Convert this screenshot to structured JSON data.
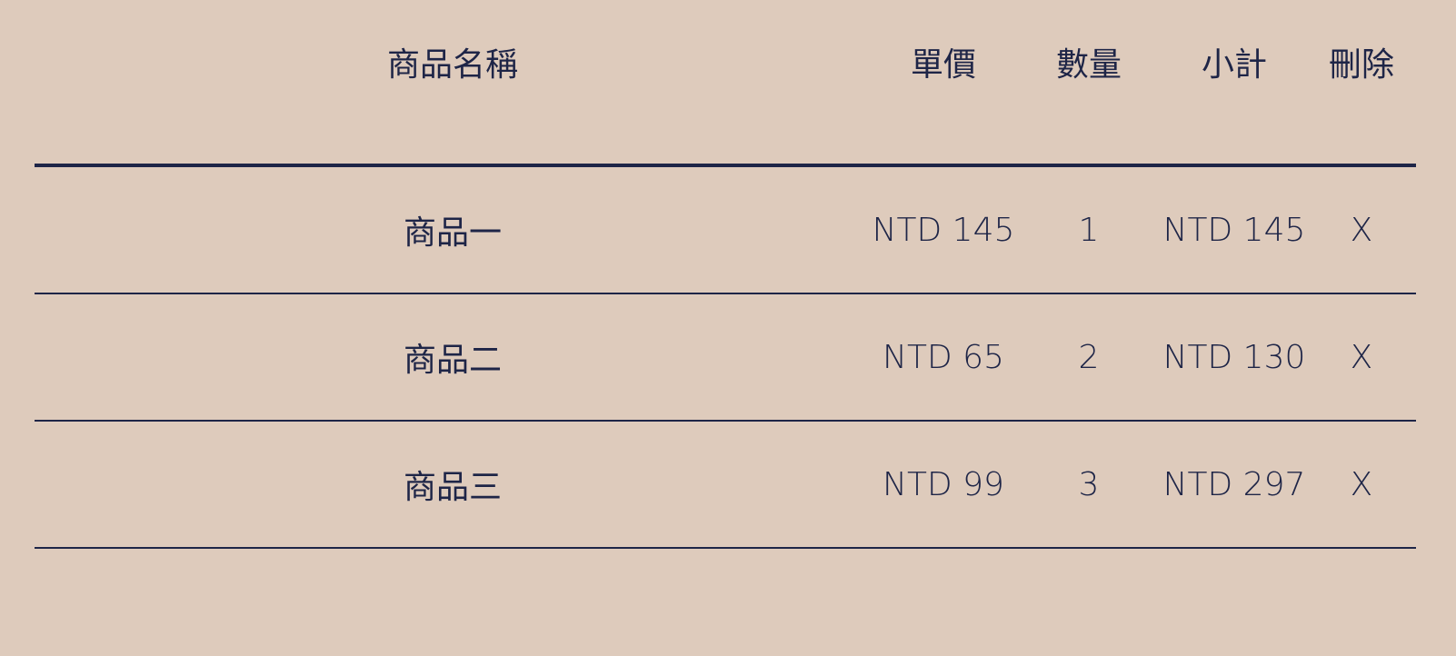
{
  "cart": {
    "headers": {
      "name": "商品名稱",
      "price": "單價",
      "quantity": "數量",
      "subtotal": "小計",
      "delete": "刪除"
    },
    "items": [
      {
        "name": "商品一",
        "price": "NTD 145",
        "quantity": "1",
        "subtotal": "NTD 145",
        "delete": "X"
      },
      {
        "name": "商品二",
        "price": "NTD 65",
        "quantity": "2",
        "subtotal": "NTD 130",
        "delete": "X"
      },
      {
        "name": "商品三",
        "price": "NTD 99",
        "quantity": "3",
        "subtotal": "NTD 297",
        "delete": "X"
      }
    ]
  },
  "colors": {
    "background": "#decbbc",
    "text": "#1e2547",
    "rule": "#1e2547"
  }
}
